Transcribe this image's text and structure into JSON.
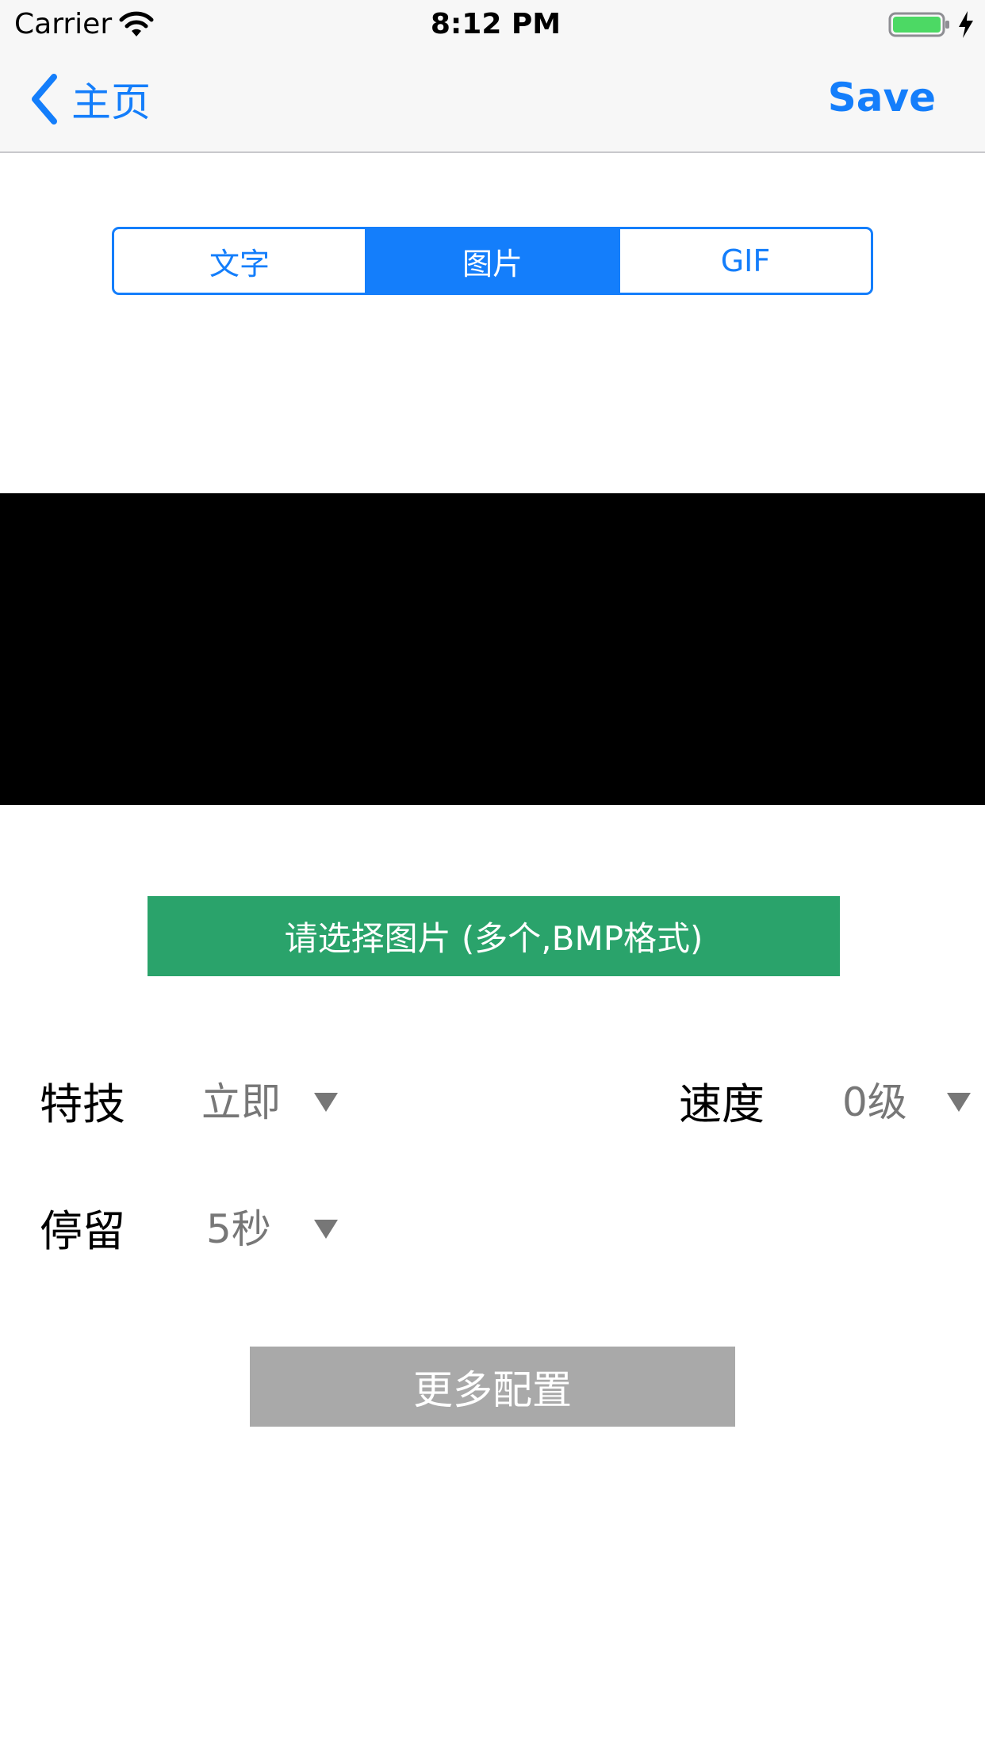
{
  "status_bar": {
    "carrier": "Carrier",
    "time": "8:12 PM",
    "icons": [
      "wifi-icon",
      "battery-icon",
      "charging-bolt-icon"
    ],
    "battery_color": "#4cd964"
  },
  "nav": {
    "back_label": "主页",
    "save_label": "Save",
    "tint_color": "#147efb"
  },
  "segments": {
    "items": [
      "文字",
      "图片",
      "GIF"
    ],
    "selected_index": 1
  },
  "select_button": {
    "label": "请选择图片 (多个,BMP格式)",
    "color": "#2aa36b"
  },
  "settings": {
    "effect": {
      "label": "特技",
      "value": "立即"
    },
    "speed": {
      "label": "速度",
      "value": "0级"
    },
    "stay": {
      "label": "停留",
      "value": "5秒"
    }
  },
  "more_button": {
    "label": "更多配置",
    "color": "#a9a9a9"
  }
}
